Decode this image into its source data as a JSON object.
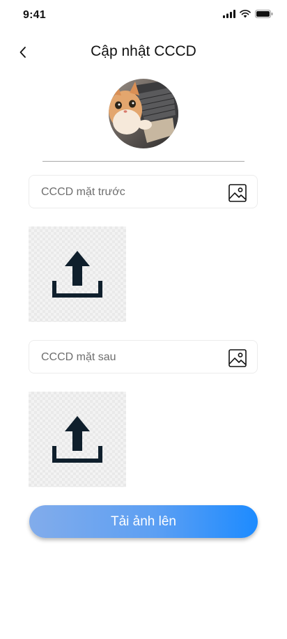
{
  "status_bar": {
    "time": "9:41"
  },
  "header": {
    "title": "Cập nhật CCCD"
  },
  "front_id": {
    "label": "CCCD mặt trước"
  },
  "back_id": {
    "label": "CCCD mặt sau"
  },
  "submit": {
    "label": "Tải ảnh lên"
  },
  "colors": {
    "accent": "#1d8bff",
    "upload_icon": "#0f1f2c"
  },
  "icons": [
    "back-chevron-icon",
    "image-icon",
    "upload-icon",
    "signal-icon",
    "wifi-icon",
    "battery-icon"
  ]
}
